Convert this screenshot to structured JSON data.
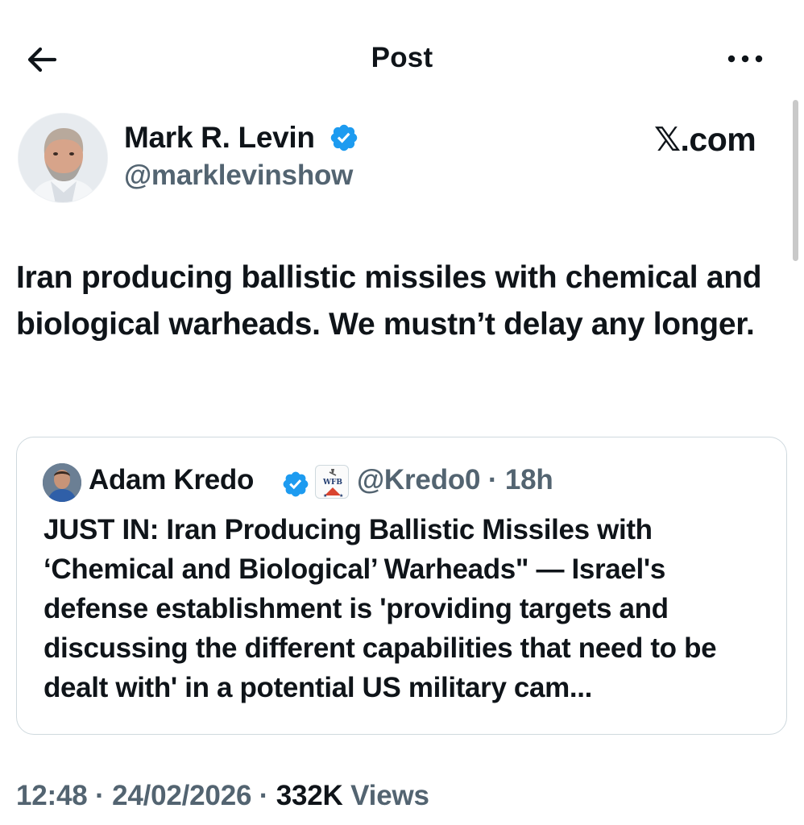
{
  "header": {
    "title": "Post",
    "back_icon": "arrow-left-icon",
    "more_icon": "more-horizontal-icon"
  },
  "post": {
    "author": {
      "name": "Mark R. Levin",
      "handle": "@marklevinshow",
      "verified": true
    },
    "source_watermark": "𝕏.com",
    "text": "Iran producing ballistic missiles with chemical and biological warheads. We mustn’t delay any longer.",
    "quote": {
      "author_name": "Adam Kredo",
      "verified": true,
      "affiliation_badge": "WFB",
      "handle": "@Kredo0",
      "separator": "·",
      "time": "18h",
      "text": "JUST IN: Iran Producing Ballistic Missiles with ‘Chemical and Biological’ Warheads\" — Israel's defense establishment is 'providing targets and discussing the different capabilities that need to be dealt with' in a potential US military cam..."
    },
    "meta": {
      "time": "12:48",
      "separator": "·",
      "date": "24/02/2026",
      "views_count": "332K",
      "views_label": "Views"
    }
  },
  "colors": {
    "text_primary": "#0f1419",
    "text_secondary": "#536471",
    "verified_blue": "#1d9bf0",
    "border": "#cfd9de"
  }
}
